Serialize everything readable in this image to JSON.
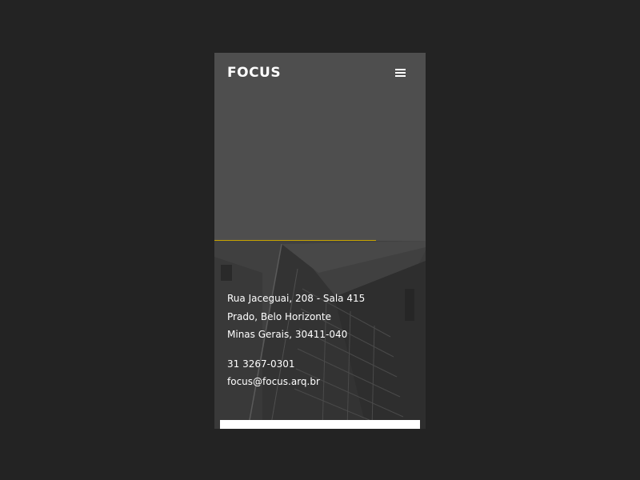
{
  "header": {
    "logo_text": "FOCUS",
    "menu_icon": "hamburger-menu-icon"
  },
  "colors": {
    "page_background": "#232323",
    "hero_background": "#4e4e4e",
    "accent": "#c8a400",
    "text": "#ffffff"
  },
  "contact": {
    "address_line_1": "Rua Jaceguai, 208 - Sala 415",
    "address_line_2": "Prado, Belo Horizonte",
    "address_line_3": "Minas Gerais, 30411-040",
    "phone": "31 3267-0301",
    "email": "focus@focus.arq.br"
  }
}
